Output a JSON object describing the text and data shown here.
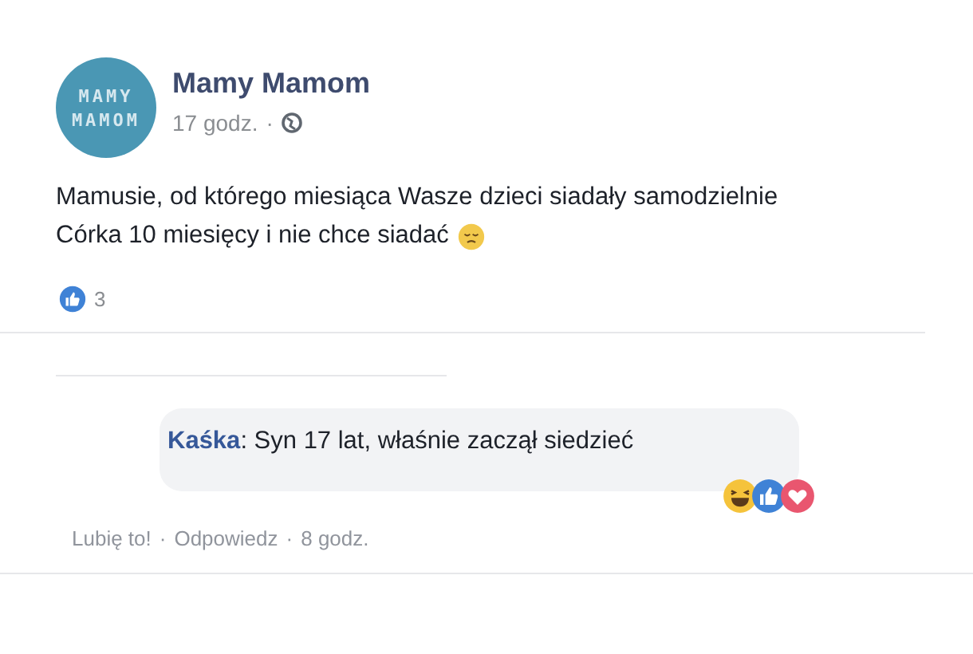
{
  "post": {
    "avatar_lines": [
      "MAMY",
      "MAMOM"
    ],
    "author": "Mamy Mamom",
    "time": "17 godz.",
    "separator": "·",
    "lines": [
      "Mamusie, od którego miesiąca Wasze dzieci siadały samodzielnie",
      "Córka 10 miesięcy i nie chce siadać"
    ],
    "reactions": [
      {
        "kind": "like"
      }
    ],
    "reaction_count": "3"
  },
  "comment": {
    "author": "Kaśka",
    "text": ": Syn 17 lat, właśnie zaczął siedzieć",
    "reactions": [
      {
        "kind": "haha"
      },
      {
        "kind": "like"
      },
      {
        "kind": "love"
      }
    ],
    "actions": [
      "Lubię to!",
      "Odpowiedz"
    ],
    "separator": "·",
    "time": "8 godz."
  }
}
